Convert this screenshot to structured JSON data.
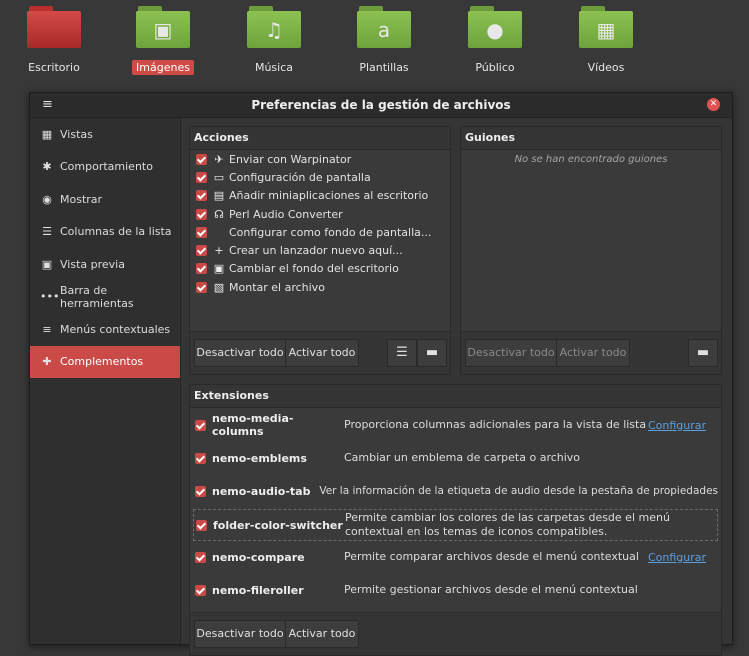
{
  "desktop": {
    "folders": [
      {
        "label": "Escritorio",
        "selected": false
      },
      {
        "label": "Imágenes",
        "selected": true
      },
      {
        "label": "Música",
        "selected": false
      },
      {
        "label": "Plantillas",
        "selected": false
      },
      {
        "label": "Público",
        "selected": false
      },
      {
        "label": "Vídeos",
        "selected": false
      }
    ]
  },
  "window": {
    "title": "Preferencias de la gestión de archivos",
    "menu_icon": "hamburger-icon",
    "close_icon": "close-icon"
  },
  "sidebar": {
    "items": [
      {
        "label": "Vistas",
        "icon": "grid-icon"
      },
      {
        "label": "Comportamiento",
        "icon": "gear-icon"
      },
      {
        "label": "Mostrar",
        "icon": "eye-icon"
      },
      {
        "label": "Columnas de la lista",
        "icon": "list-columns-icon"
      },
      {
        "label": "Vista previa",
        "icon": "image-icon"
      },
      {
        "label": "Barra de herramientas",
        "icon": "dots-icon"
      },
      {
        "label": "Menús contextuales",
        "icon": "menu-lines-icon"
      },
      {
        "label": "Complementos",
        "icon": "puzzle-icon",
        "active": true
      }
    ]
  },
  "acciones": {
    "header": "Acciones",
    "items": [
      {
        "label": "Enviar con Warpinator",
        "checked": true
      },
      {
        "label": "Configuración de pantalla",
        "checked": true
      },
      {
        "label": "Añadir miniaplicaciones al escritorio",
        "checked": true
      },
      {
        "label": "Perl Audio Converter",
        "checked": true
      },
      {
        "label": "Configurar como fondo de pantalla...",
        "checked": true
      },
      {
        "label": "Crear un lanzador nuevo aquí...",
        "checked": true
      },
      {
        "label": "Cambiar el fondo del escritorio",
        "checked": true
      },
      {
        "label": "Montar el archivo",
        "checked": true
      }
    ],
    "disable_all": "Desactivar todo",
    "enable_all": "Activar todo"
  },
  "guiones": {
    "header": "Guiones",
    "empty": "No se han encontrado guiones",
    "disable_all": "Desactivar todo",
    "enable_all": "Activar todo"
  },
  "extensiones": {
    "header": "Extensiones",
    "items": [
      {
        "name": "nemo-media-columns",
        "desc": "Proporciona columnas adicionales para la vista de lista",
        "configure": "Configurar",
        "checked": true
      },
      {
        "name": "nemo-emblems",
        "desc": "Cambiar un emblema de carpeta o archivo",
        "configure": "",
        "checked": true
      },
      {
        "name": "nemo-audio-tab",
        "desc": "Ver la información de la etiqueta de audio desde la pestaña de propiedades",
        "configure": "",
        "checked": true
      },
      {
        "name": "folder-color-switcher",
        "desc": "Permite cambiar los colores de las carpetas desde el menú contextual en los temas de iconos compatibles.",
        "configure": "",
        "checked": true
      },
      {
        "name": "nemo-compare",
        "desc": "Permite comparar archivos desde el menú contextual",
        "configure": "Configurar",
        "checked": true
      },
      {
        "name": "nemo-fileroller",
        "desc": "Permite gestionar archivos desde el menú contextual",
        "configure": "",
        "checked": true
      }
    ],
    "disable_all": "Desactivar todo",
    "enable_all": "Activar todo"
  },
  "colors": {
    "accent": "#c94a46",
    "link": "#5aa0e0",
    "folder_green": "#8cc152",
    "folder_red": "#d44a47"
  }
}
